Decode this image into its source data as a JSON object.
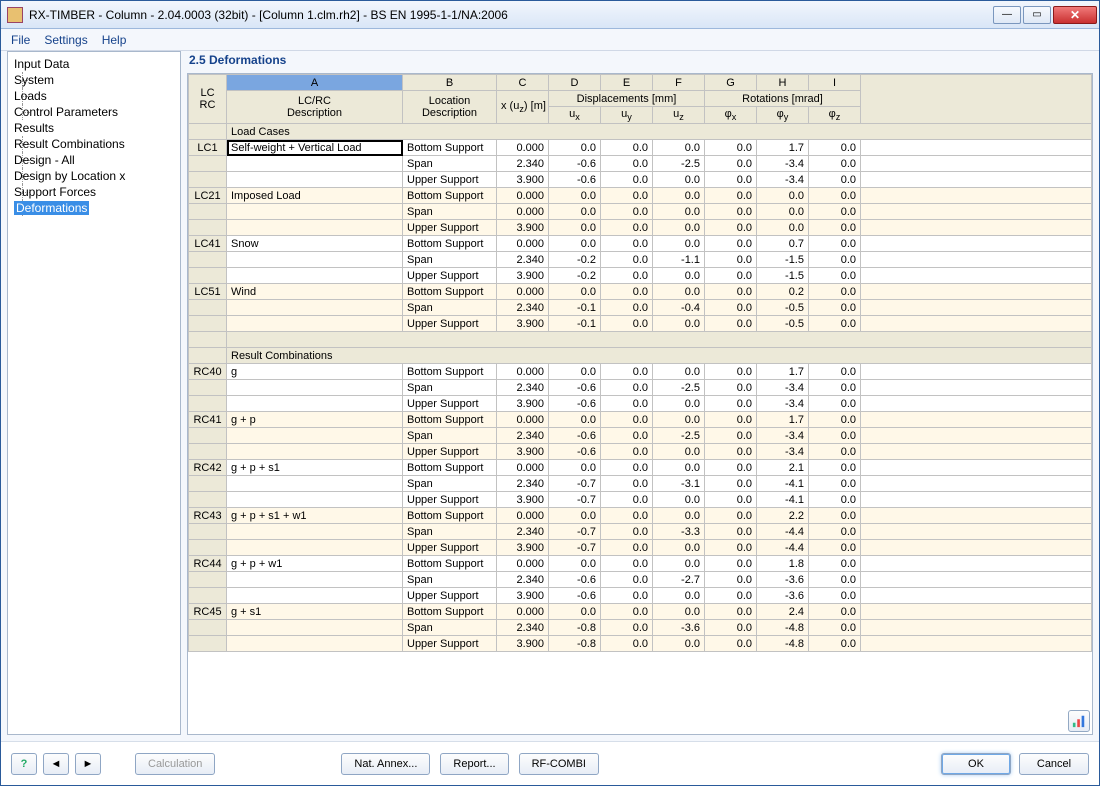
{
  "title": "RX-TIMBER - Column - 2.04.0003 (32bit) - [Column 1.clm.rh2] - BS EN 1995-1-1/NA:2006",
  "menu": {
    "file": "File",
    "settings": "Settings",
    "help": "Help"
  },
  "tree": {
    "input": "Input Data",
    "system": "System",
    "loads": "Loads",
    "ctrl": "Control Parameters",
    "results": "Results",
    "rc": "Result Combinations",
    "dall": "Design - All",
    "dloc": "Design by Location x",
    "sf": "Support Forces",
    "def": "Deformations"
  },
  "panelTitle": "2.5 Deformations",
  "letters": [
    "A",
    "B",
    "C",
    "D",
    "E",
    "F",
    "G",
    "H",
    "I"
  ],
  "headers": {
    "lcrc": "LC\nRC",
    "a": "LC/RC\nDescription",
    "b": "Location\nDescription",
    "c": "x (u<sub>z</sub>) [m]",
    "disp": "Displacements [mm]",
    "rot": "Rotations [mrad]",
    "d": "u<sub>x</sub>",
    "e": "u<sub>y</sub>",
    "f": "u<sub>z</sub>",
    "g": "φ<sub>x</sub>",
    "h": "φ<sub>y</sub>",
    "i": "φ<sub>z</sub>"
  },
  "sections": {
    "lc": "Load Cases",
    "rc": "Result Combinations"
  },
  "groups": [
    {
      "section": "lc",
      "id": "LC1",
      "desc": "Self-weight + Vertical Load",
      "rows": [
        [
          "Bottom Support",
          "0.000",
          "0.0",
          "0.0",
          "0.0",
          "0.0",
          "1.7",
          "0.0"
        ],
        [
          "Span",
          "2.340",
          "-0.6",
          "0.0",
          "-2.5",
          "0.0",
          "-3.4",
          "0.0"
        ],
        [
          "Upper Support",
          "3.900",
          "-0.6",
          "0.0",
          "0.0",
          "0.0",
          "-3.4",
          "0.0"
        ]
      ]
    },
    {
      "id": "LC21",
      "desc": "Imposed Load",
      "rows": [
        [
          "Bottom Support",
          "0.000",
          "0.0",
          "0.0",
          "0.0",
          "0.0",
          "0.0",
          "0.0"
        ],
        [
          "Span",
          "0.000",
          "0.0",
          "0.0",
          "0.0",
          "0.0",
          "0.0",
          "0.0"
        ],
        [
          "Upper Support",
          "3.900",
          "0.0",
          "0.0",
          "0.0",
          "0.0",
          "0.0",
          "0.0"
        ]
      ]
    },
    {
      "id": "LC41",
      "desc": "Snow",
      "rows": [
        [
          "Bottom Support",
          "0.000",
          "0.0",
          "0.0",
          "0.0",
          "0.0",
          "0.7",
          "0.0"
        ],
        [
          "Span",
          "2.340",
          "-0.2",
          "0.0",
          "-1.1",
          "0.0",
          "-1.5",
          "0.0"
        ],
        [
          "Upper Support",
          "3.900",
          "-0.2",
          "0.0",
          "0.0",
          "0.0",
          "-1.5",
          "0.0"
        ]
      ]
    },
    {
      "id": "LC51",
      "desc": "Wind",
      "rows": [
        [
          "Bottom Support",
          "0.000",
          "0.0",
          "0.0",
          "0.0",
          "0.0",
          "0.2",
          "0.0"
        ],
        [
          "Span",
          "2.340",
          "-0.1",
          "0.0",
          "-0.4",
          "0.0",
          "-0.5",
          "0.0"
        ],
        [
          "Upper Support",
          "3.900",
          "-0.1",
          "0.0",
          "0.0",
          "0.0",
          "-0.5",
          "0.0"
        ]
      ]
    },
    {
      "section": "rc",
      "id": "RC40",
      "desc": "g",
      "rows": [
        [
          "Bottom Support",
          "0.000",
          "0.0",
          "0.0",
          "0.0",
          "0.0",
          "1.7",
          "0.0"
        ],
        [
          "Span",
          "2.340",
          "-0.6",
          "0.0",
          "-2.5",
          "0.0",
          "-3.4",
          "0.0"
        ],
        [
          "Upper Support",
          "3.900",
          "-0.6",
          "0.0",
          "0.0",
          "0.0",
          "-3.4",
          "0.0"
        ]
      ]
    },
    {
      "id": "RC41",
      "desc": "g + p",
      "rows": [
        [
          "Bottom Support",
          "0.000",
          "0.0",
          "0.0",
          "0.0",
          "0.0",
          "1.7",
          "0.0"
        ],
        [
          "Span",
          "2.340",
          "-0.6",
          "0.0",
          "-2.5",
          "0.0",
          "-3.4",
          "0.0"
        ],
        [
          "Upper Support",
          "3.900",
          "-0.6",
          "0.0",
          "0.0",
          "0.0",
          "-3.4",
          "0.0"
        ]
      ]
    },
    {
      "id": "RC42",
      "desc": "g + p + s1",
      "rows": [
        [
          "Bottom Support",
          "0.000",
          "0.0",
          "0.0",
          "0.0",
          "0.0",
          "2.1",
          "0.0"
        ],
        [
          "Span",
          "2.340",
          "-0.7",
          "0.0",
          "-3.1",
          "0.0",
          "-4.1",
          "0.0"
        ],
        [
          "Upper Support",
          "3.900",
          "-0.7",
          "0.0",
          "0.0",
          "0.0",
          "-4.1",
          "0.0"
        ]
      ]
    },
    {
      "id": "RC43",
      "desc": "g + p + s1 + w1",
      "rows": [
        [
          "Bottom Support",
          "0.000",
          "0.0",
          "0.0",
          "0.0",
          "0.0",
          "2.2",
          "0.0"
        ],
        [
          "Span",
          "2.340",
          "-0.7",
          "0.0",
          "-3.3",
          "0.0",
          "-4.4",
          "0.0"
        ],
        [
          "Upper Support",
          "3.900",
          "-0.7",
          "0.0",
          "0.0",
          "0.0",
          "-4.4",
          "0.0"
        ]
      ]
    },
    {
      "id": "RC44",
      "desc": "g + p + w1",
      "rows": [
        [
          "Bottom Support",
          "0.000",
          "0.0",
          "0.0",
          "0.0",
          "0.0",
          "1.8",
          "0.0"
        ],
        [
          "Span",
          "2.340",
          "-0.6",
          "0.0",
          "-2.7",
          "0.0",
          "-3.6",
          "0.0"
        ],
        [
          "Upper Support",
          "3.900",
          "-0.6",
          "0.0",
          "0.0",
          "0.0",
          "-3.6",
          "0.0"
        ]
      ]
    },
    {
      "id": "RC45",
      "desc": "g + s1",
      "rows": [
        [
          "Bottom Support",
          "0.000",
          "0.0",
          "0.0",
          "0.0",
          "0.0",
          "2.4",
          "0.0"
        ],
        [
          "Span",
          "2.340",
          "-0.8",
          "0.0",
          "-3.6",
          "0.0",
          "-4.8",
          "0.0"
        ],
        [
          "Upper Support",
          "3.900",
          "-0.8",
          "0.0",
          "0.0",
          "0.0",
          "-4.8",
          "0.0"
        ]
      ]
    }
  ],
  "buttons": {
    "calc": "Calculation",
    "annex": "Nat. Annex...",
    "report": "Report...",
    "combi": "RF-COMBI",
    "ok": "OK",
    "cancel": "Cancel"
  }
}
